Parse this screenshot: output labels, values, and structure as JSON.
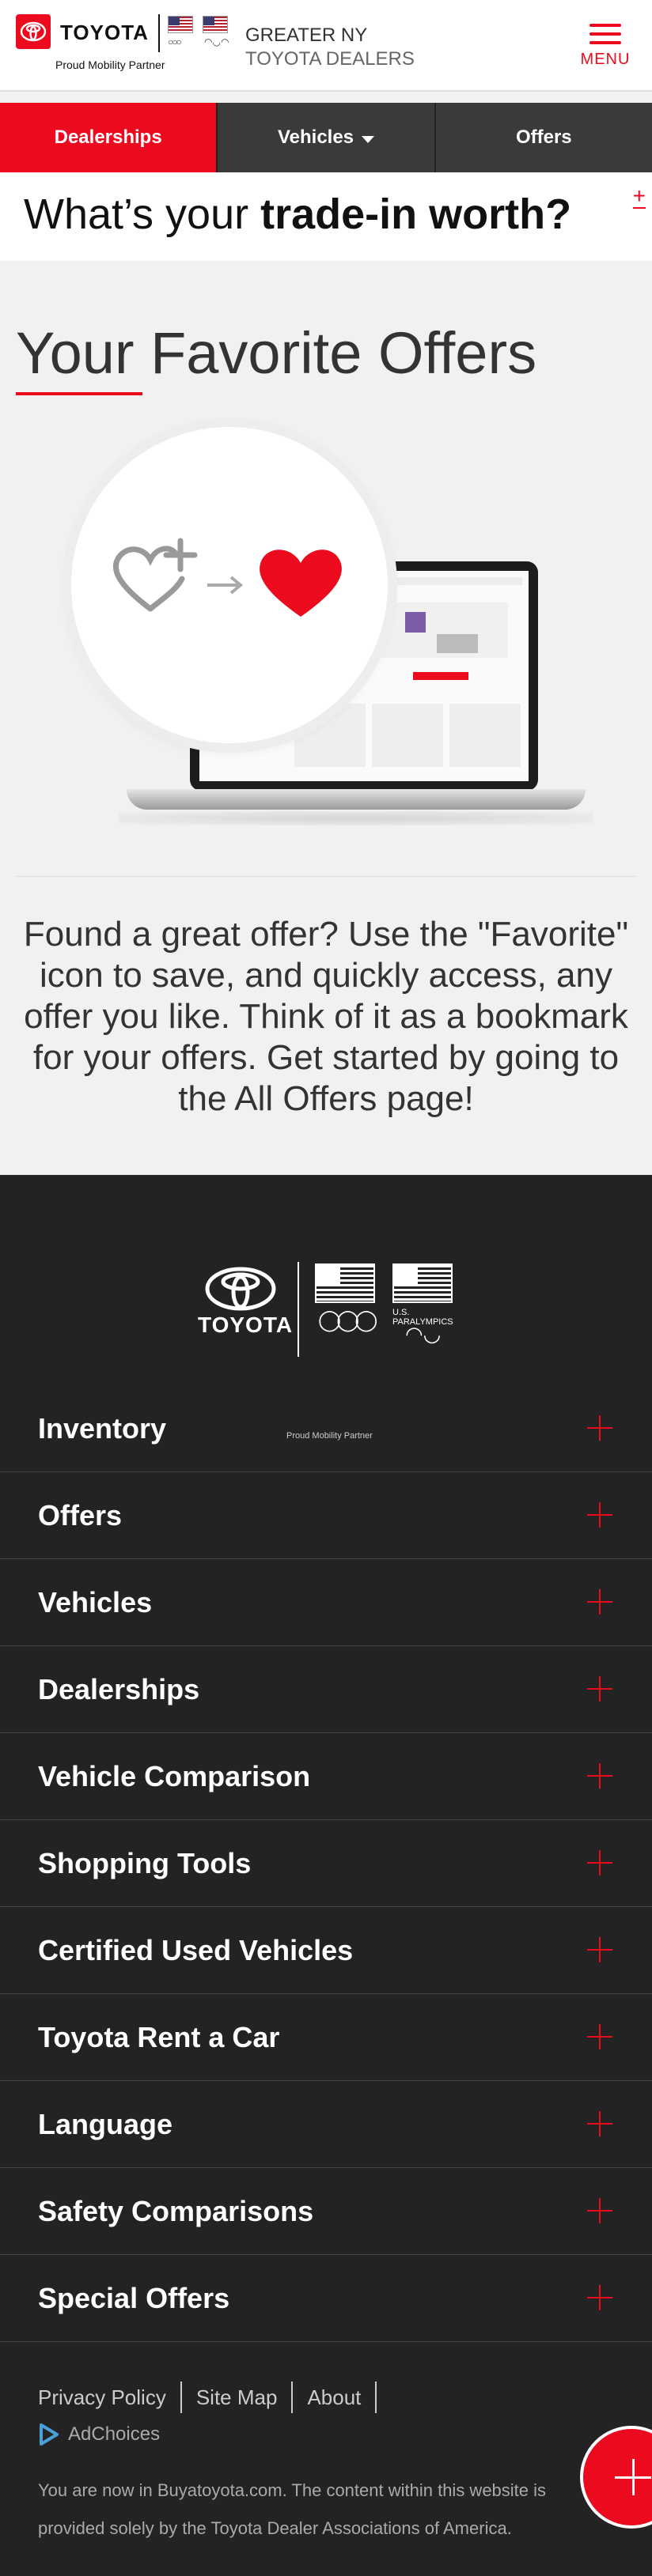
{
  "header": {
    "brand_word": "TOYOTA",
    "brand_tagline": "Proud Mobility Partner",
    "dealer_name_line1": "GREATER NY",
    "dealer_name_line2": "TOYOTA DEALERS",
    "menu_label": "MENU"
  },
  "nav": {
    "items": [
      {
        "label": "Dealerships",
        "active": true
      },
      {
        "label": "Vehicles",
        "dropdown": true
      },
      {
        "label": "Offers"
      }
    ]
  },
  "tradein": {
    "text_regular": "What’s your ",
    "text_bold": "trade-in worth?",
    "plus_icon": "+"
  },
  "favorites": {
    "title": "Your Favorite Offers",
    "description": "Found a great offer? Use the \"Favorite\" icon to save, and quickly access, any offer you like. Think of it as a bookmark for your offers. Get started by going to the All Offers page!"
  },
  "footer": {
    "logo_word": "TOYOTA",
    "logo_tagline": "Proud Mobility Partner",
    "paralympics_label": "U.S. PARALYMPICS",
    "accordion": [
      "Inventory",
      "Offers",
      "Vehicles",
      "Dealerships",
      "Vehicle Comparison",
      "Shopping Tools",
      "Certified Used Vehicles",
      "Toyota Rent a Car",
      "Language",
      "Safety Comparisons",
      "Special Offers"
    ],
    "legal_links": [
      "Privacy Policy",
      "Site Map",
      "About"
    ],
    "adchoices": "AdChoices",
    "disclaimer": "You are now in Buyatoyota.com. The content within this website is provided solely by the Toyota Dealer Associations of America."
  },
  "colors": {
    "brand_red": "#eb0a1e",
    "footer_bg": "#232323",
    "nav_bg": "#3a3a3a"
  }
}
